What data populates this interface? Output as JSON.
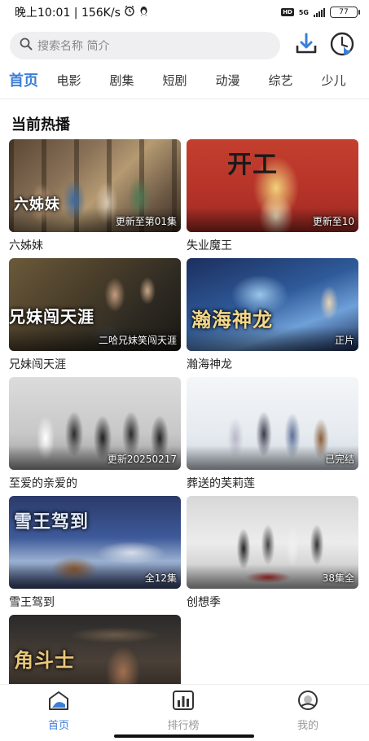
{
  "status_bar": {
    "time_speed": "晚上10:01 | 156K/s",
    "network": "5G",
    "hd": "HD",
    "battery": "77"
  },
  "header": {
    "search_placeholder": "搜索名称 简介"
  },
  "tabs": [
    "首页",
    "电影",
    "剧集",
    "短剧",
    "动漫",
    "综艺",
    "少儿"
  ],
  "section_title": "当前热播",
  "items": [
    {
      "title": "六姊妹",
      "badge": "更新至第01集",
      "overlay": "六姊妹"
    },
    {
      "title": "失业魔王",
      "badge": "更新至10",
      "overlay": "开工"
    },
    {
      "title": "兄妹闯天涯",
      "badge": "二哈兄妹笑闯天涯",
      "overlay": "兄妹闯天涯"
    },
    {
      "title": "瀚海神龙",
      "badge": "正片",
      "overlay": "瀚海神龙"
    },
    {
      "title": "至爱的亲爱的",
      "badge": "更新20250217",
      "overlay": ""
    },
    {
      "title": "葬送的芙莉莲",
      "badge": "已完结",
      "overlay": ""
    },
    {
      "title": "雪王驾到",
      "badge": "全12集",
      "overlay": "雪王驾到"
    },
    {
      "title": "创想季",
      "badge": "38集全",
      "overlay": ""
    },
    {
      "title": "",
      "badge": "",
      "overlay": "角斗士"
    }
  ],
  "bottom_nav": [
    "首页",
    "排行榜",
    "我的"
  ],
  "colors": {
    "accent": "#3b7fd9",
    "search_bg": "#efeff1"
  },
  "icons": [
    "search-icon",
    "download-icon",
    "history-icon",
    "home-icon",
    "ranking-icon",
    "profile-icon",
    "alarm-icon",
    "app-notification-icon"
  ]
}
